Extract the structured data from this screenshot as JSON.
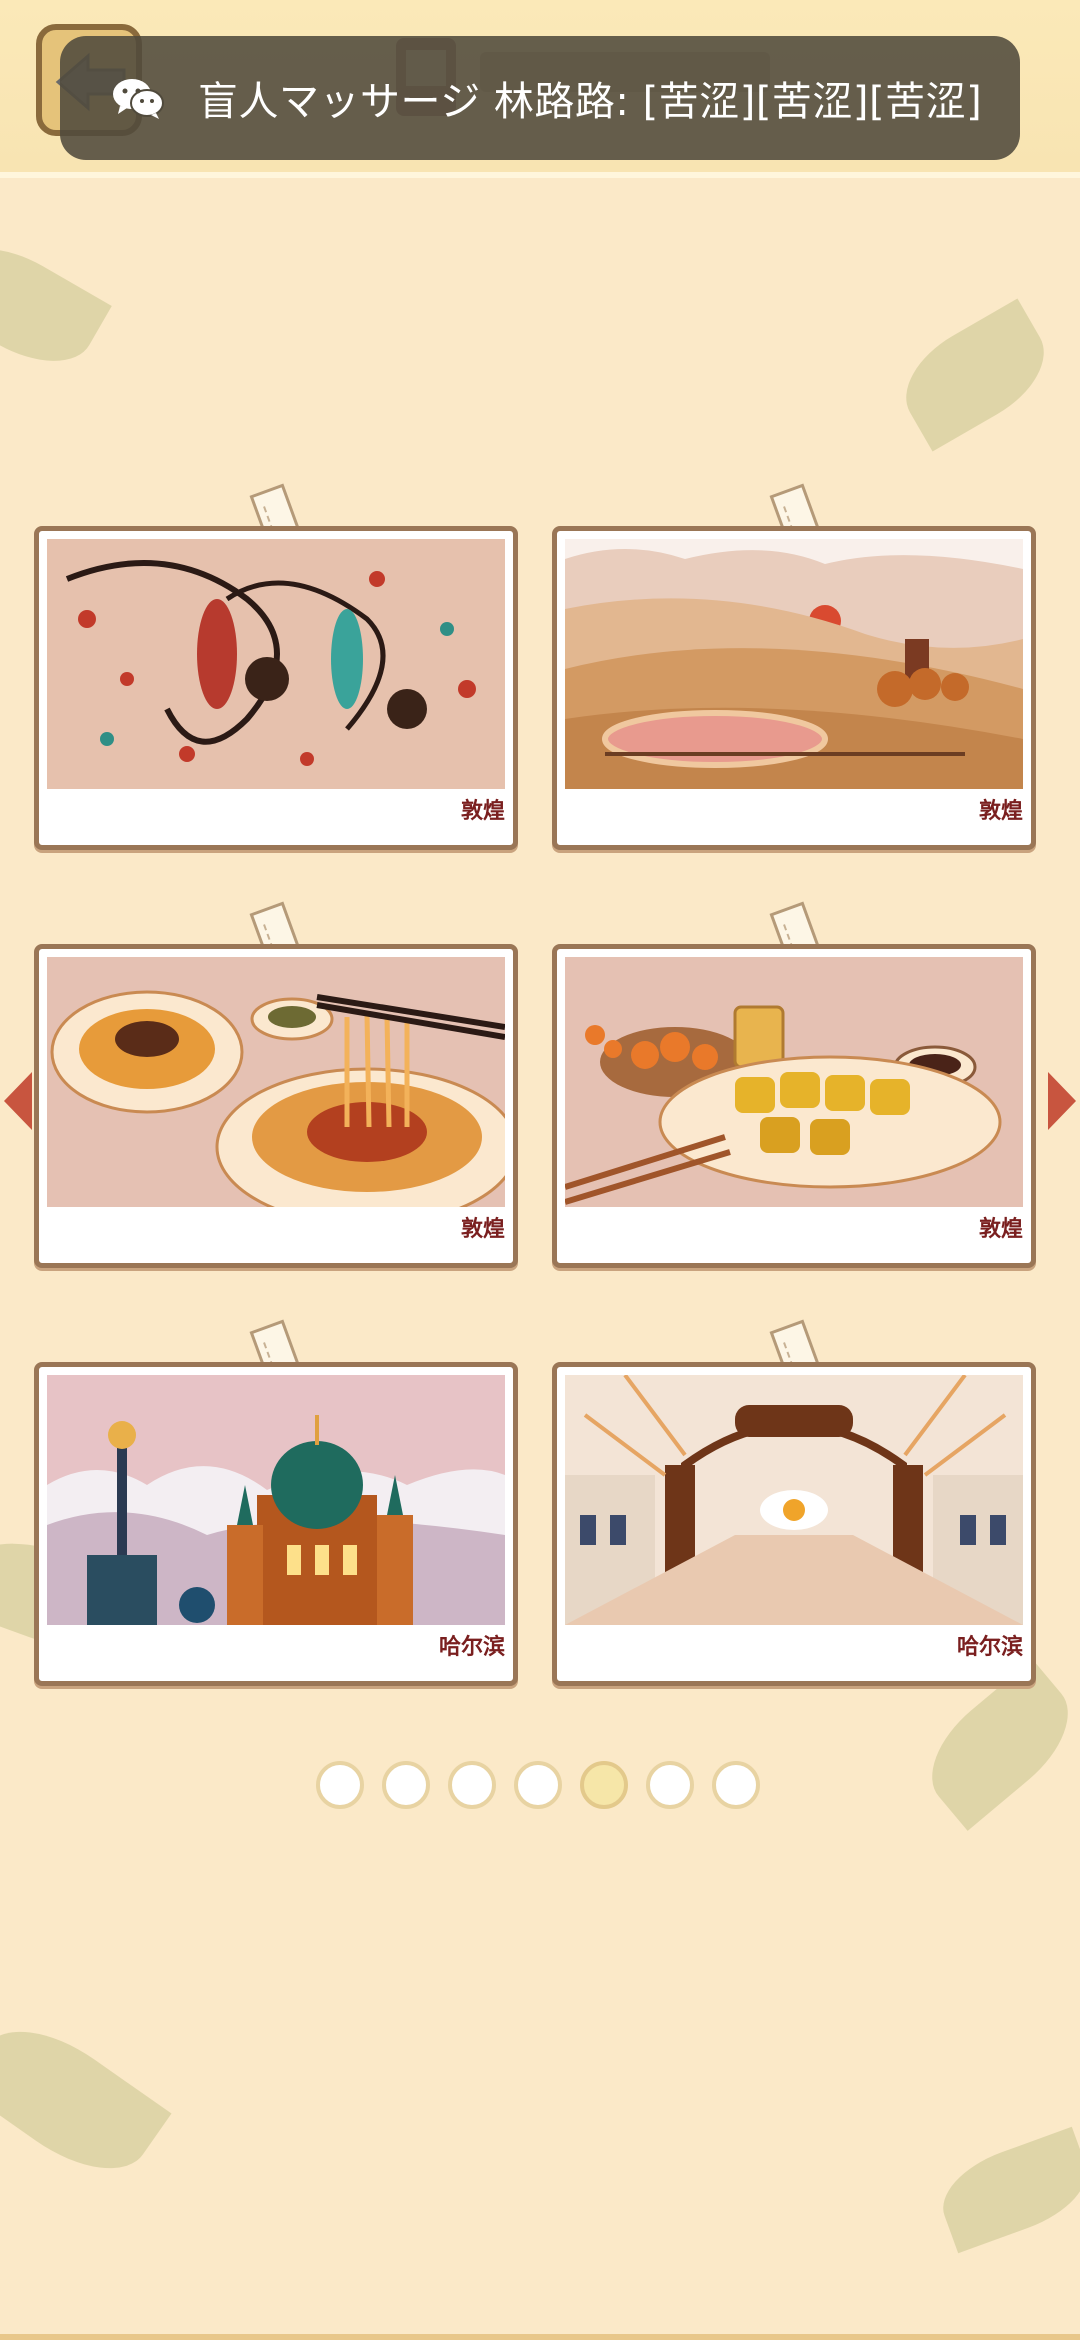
{
  "notification": {
    "icon": "wechat-icon",
    "text": "盲人マッサージ  林路路: [苦涩][苦涩][苦涩]"
  },
  "header": {
    "back_icon": "arrow-left-icon"
  },
  "cards": [
    {
      "caption": "敦煌",
      "art": "flying-apsaras-mural"
    },
    {
      "caption": "敦煌",
      "art": "desert-oasis-crescent-lake"
    },
    {
      "caption": "敦煌",
      "art": "noodles-dish"
    },
    {
      "caption": "敦煌",
      "art": "fried-rolls-dish"
    },
    {
      "caption": "哈尔滨",
      "art": "onion-dome-cathedral"
    },
    {
      "caption": "哈尔滨",
      "art": "central-street-gate"
    }
  ],
  "pagination": {
    "total": 7,
    "active_index": 4
  },
  "colors": {
    "background": "#fbe9c8",
    "card_border": "#9a7656",
    "caption": "#7a1f1f",
    "toast_bg": "#504a3c"
  }
}
